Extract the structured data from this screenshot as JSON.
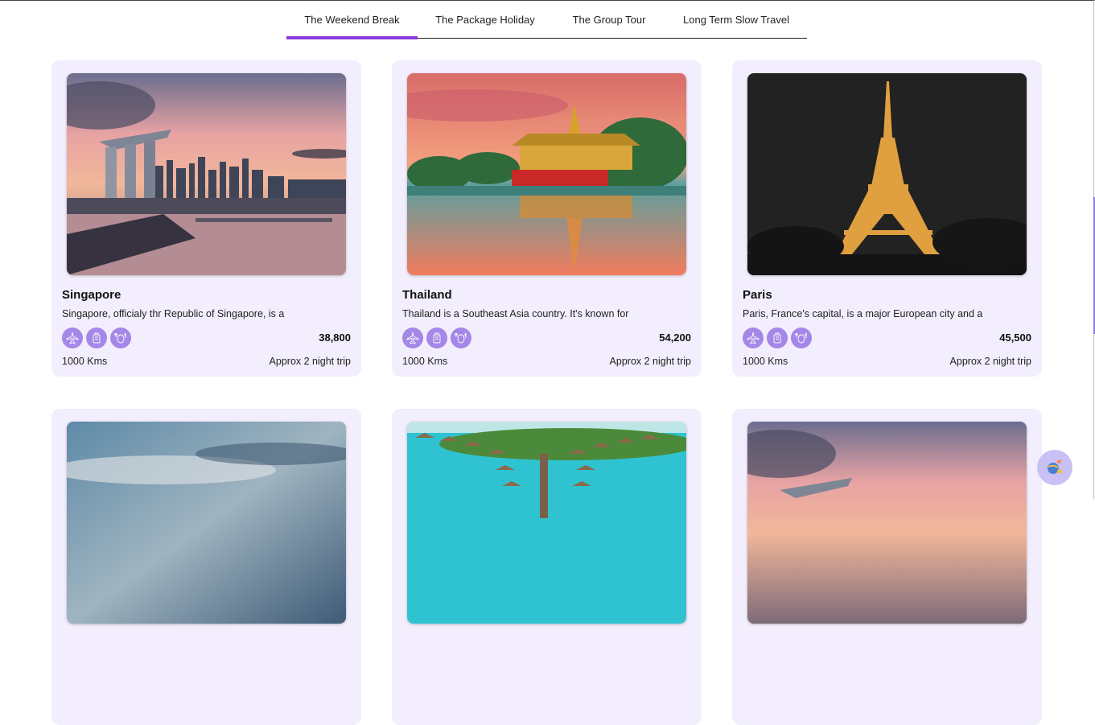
{
  "tabs": [
    {
      "label": "The Weekend Break",
      "active": true
    },
    {
      "label": "The Package Holiday",
      "active": false
    },
    {
      "label": "The Group Tour",
      "active": false
    },
    {
      "label": "Long Term Slow Travel",
      "active": false
    }
  ],
  "colors": {
    "accent": "#8b3bdc",
    "card_bg": "#f3eefd",
    "icon_bg": "#a487e6"
  },
  "feature_icons": [
    "airplane-icon",
    "luggage-icon",
    "meal-icon"
  ],
  "cards": [
    {
      "title": "Singapore",
      "description": "Singapore, officialy thr Republic of Singapore, is a",
      "price": "38,800",
      "distance": "1000 Kms",
      "duration": "Approx 2 night trip",
      "image": "singapore-skyline"
    },
    {
      "title": "Thailand",
      "description": "Thailand is a Southeast Asia country. It's known for",
      "price": "54,200",
      "distance": "1000 Kms",
      "duration": "Approx 2 night trip",
      "image": "thailand-temple"
    },
    {
      "title": "Paris",
      "description": "Paris, France's capital, is a major European city and a",
      "price": "45,500",
      "distance": "1000 Kms",
      "duration": "Approx 2 night trip",
      "image": "eiffel-tower"
    },
    {
      "image": "cloudy-sky"
    },
    {
      "image": "overwater-bungalows"
    },
    {
      "image": "singapore-skyline"
    }
  ],
  "fab": {
    "icon": "travel-assistant-icon"
  }
}
